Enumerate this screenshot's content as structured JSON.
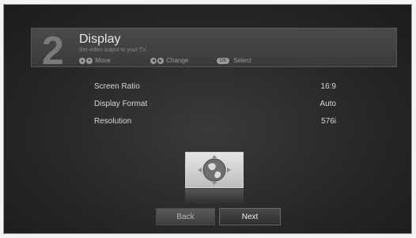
{
  "header": {
    "step_number": "2",
    "title": "Display",
    "subtitle": "Set video output to your TV.",
    "hints": [
      {
        "keys": [
          "▲",
          "▼"
        ],
        "label": "Move"
      },
      {
        "keys": [
          "◀",
          "▶"
        ],
        "label": "Change"
      },
      {
        "keys": [
          "OK"
        ],
        "label": "Select"
      }
    ]
  },
  "settings": [
    {
      "label": "Screen Ratio",
      "value": "16:9"
    },
    {
      "label": "Display Format",
      "value": "Auto"
    },
    {
      "label": "Resolution",
      "value": "576i"
    }
  ],
  "illustration": {
    "icon": "globe-icon"
  },
  "buttons": {
    "back": "Back",
    "next": "Next"
  },
  "colors": {
    "background": "#2a2a2a",
    "text": "#d6d6d6",
    "accent": "#e8e8e8"
  }
}
